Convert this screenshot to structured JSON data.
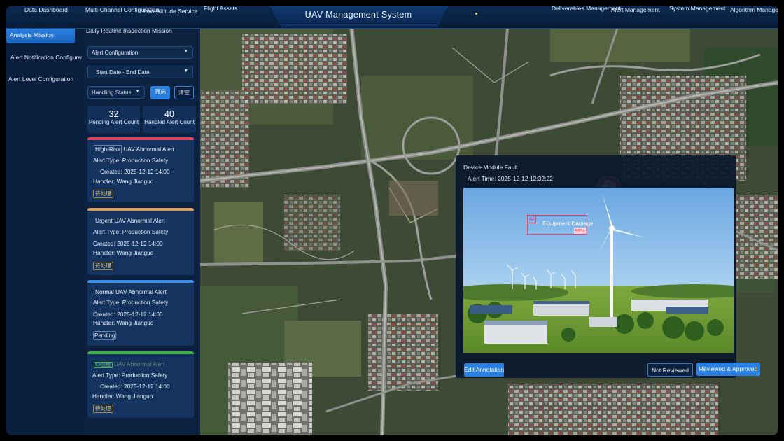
{
  "app": {
    "title": "UAV Management System"
  },
  "nav": {
    "left": [
      "Data Dashboard",
      "Multi-Channel Configuration",
      "Low-Altitude Service",
      "Flight Assets"
    ],
    "right": [
      "Deliverables Management",
      "Alert Management",
      "System Management",
      "Algorithm Management"
    ]
  },
  "sidebar": {
    "items": [
      {
        "label": "Analysis Mission",
        "active": true
      },
      {
        "label": "Alert Notification Configuration",
        "active": false
      },
      {
        "label": "Alert Level Configuration",
        "active": false
      }
    ]
  },
  "panel": {
    "mission": "Daily Routine Inspection Mission",
    "alert_config": "Alert Configuration",
    "date_range": "Start Date - End Date",
    "handling_status": "Handling Status",
    "filter_button": "筛选",
    "clear_button": "清空",
    "stats": [
      {
        "value": "32",
        "label": "Pending Alert Count"
      },
      {
        "value": "40",
        "label": "Handled Alert Count"
      }
    ],
    "cards": [
      {
        "level": "High-Risk",
        "rest": " UAV Abnormal Alert",
        "type": "Alert Type: Production Safety",
        "created": "Created: 2025-12-12 14:00",
        "handler": "Handler: Wang Jianguo",
        "status": "待处理",
        "color": "#e0455d"
      },
      {
        "level": "Urgent",
        "rest": " UAV Abnormal Alert",
        "type": "Alert Type: Production Safety",
        "created": "Created: 2025-12-12 14:00",
        "handler": "Handler: Wang Jianguo",
        "status": "待处理",
        "color": "#e09a52"
      },
      {
        "level": "Normal",
        "rest": " UAV Abnormal Alert",
        "type": "Alert Type: Production Safety",
        "created": "Created: 2025-12-12 14:00",
        "handler": "Handler: Wang Jianguo",
        "status": "Pending",
        "color": "#3c8de8"
      },
      {
        "level": "Ke提醒",
        "rest": " UAV Abnormal Alert",
        "type": "Alert Type: Production Safety",
        "created": "Created: 2025-12-12 14:00",
        "handler": "Handler: Wang Jianguo",
        "status": "待处理",
        "color": "#3fb24a"
      }
    ]
  },
  "popup": {
    "title": "Device Module Fault",
    "alert_time": "Alert Time: 2025-12-12 12:32:22",
    "detection": {
      "tag": "AI",
      "label": "Equipment Damage",
      "confidence": "99%"
    },
    "edit_button": "Edit Annotation",
    "not_reviewed_button": "Not Reviewed",
    "reviewed_button": "Reviewed & Approved"
  },
  "map": {
    "marker_icon": "alert-exclamation-icon"
  },
  "colors": {
    "accent": "#2a80e0",
    "alert": "#e8345a"
  }
}
